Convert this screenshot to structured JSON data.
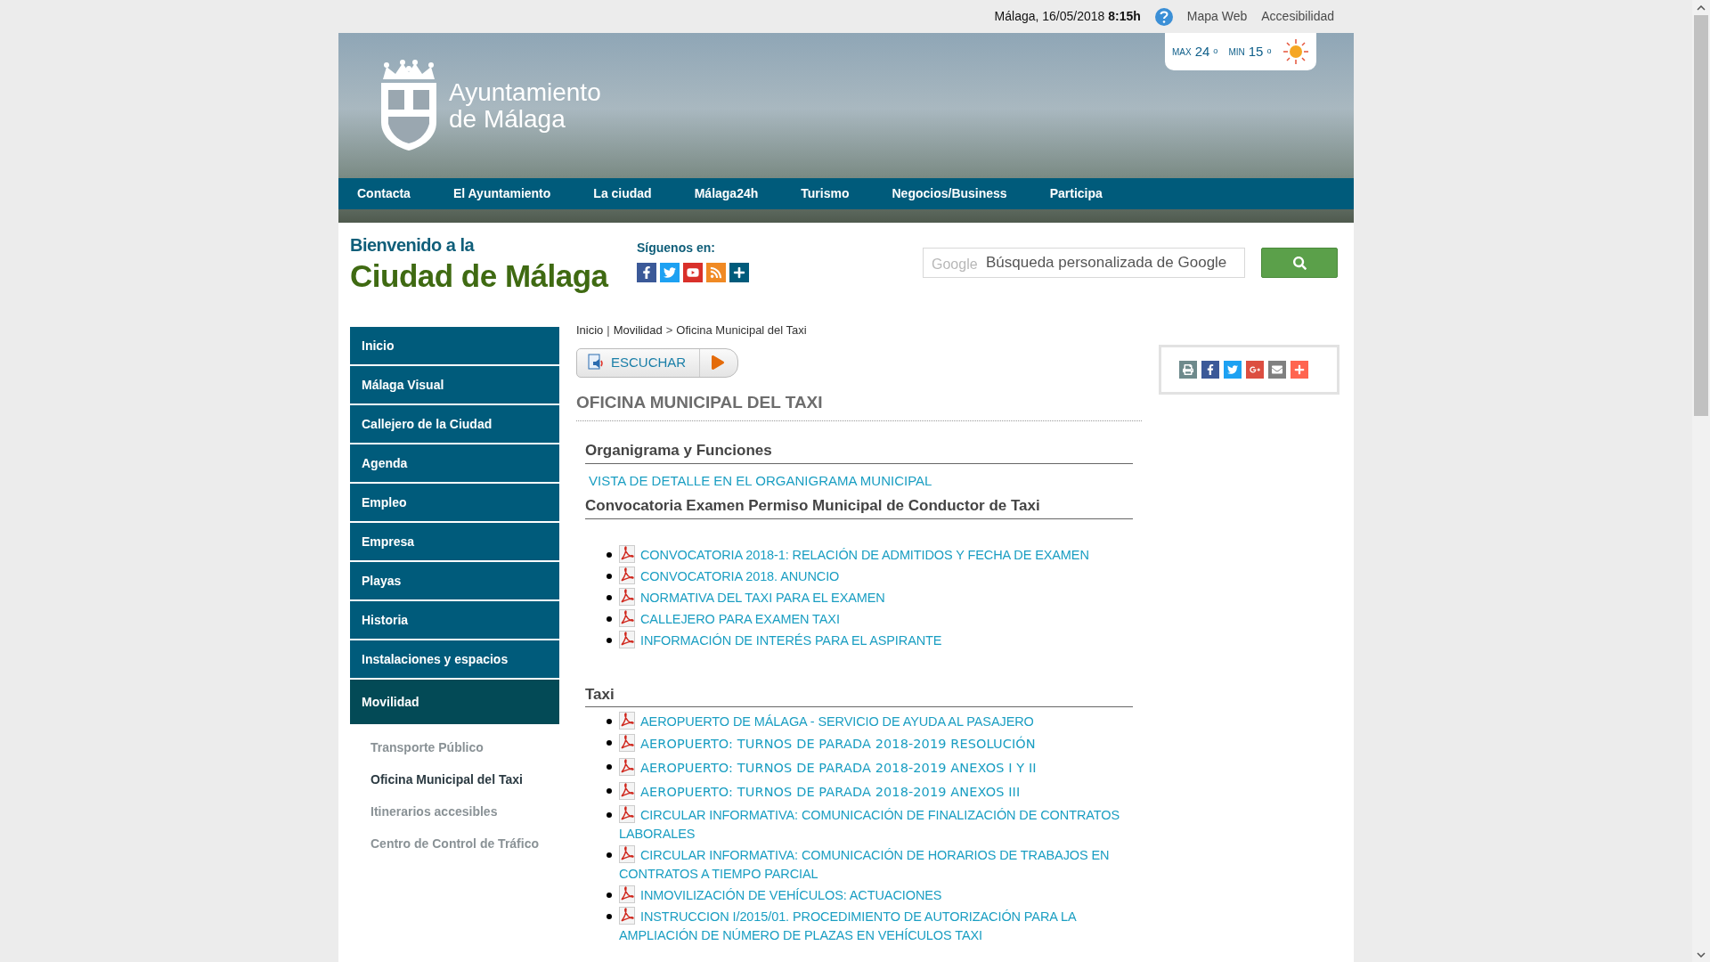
{
  "top_bar": {
    "place_date": "Málaga, 16/05/2018",
    "time": "8:15h",
    "links": [
      "Mapa Web",
      "Accesibilidad"
    ]
  },
  "banner": {
    "logo_lines": [
      "Ayuntamiento",
      "de Málaga"
    ],
    "weather": {
      "max_label": "MAX",
      "max": "24",
      "min_label": "MIN",
      "min": "15",
      "max_unit": "o",
      "min_unit": "o"
    }
  },
  "nav": [
    "Contacta",
    "El Ayuntamiento",
    "La ciudad",
    "Málaga24h",
    "Turismo",
    "Negocios/Business",
    "Participa"
  ],
  "welcome": {
    "line1": "Bienvenido a la",
    "line2": "Ciudad de Málaga"
  },
  "follow": {
    "label": "Síguenos en:",
    "networks": [
      {
        "kind": "facebook"
      },
      {
        "kind": "twitter"
      },
      {
        "kind": "youtube"
      },
      {
        "kind": "rss"
      },
      {
        "kind": "more"
      }
    ]
  },
  "search": {
    "brand": "Google",
    "placeholder": "Búsqueda personalizada de Google"
  },
  "sidebar": {
    "items": [
      {
        "label": "Inicio",
        "selected": false
      },
      {
        "label": "Málaga Visual",
        "selected": false
      },
      {
        "label": "Callejero de la Ciudad",
        "selected": false
      },
      {
        "label": "Agenda",
        "selected": false
      },
      {
        "label": "Empleo",
        "selected": false
      },
      {
        "label": "Empresa",
        "selected": false
      },
      {
        "label": "Playas",
        "selected": false
      },
      {
        "label": "Historia",
        "selected": false
      },
      {
        "label": "Instalaciones y espacios",
        "selected": false
      },
      {
        "label": "Movilidad",
        "selected": true
      }
    ],
    "subitems": [
      {
        "label": "Transporte Público",
        "selected": false
      },
      {
        "label": "Oficina Municipal del Taxi",
        "selected": true
      },
      {
        "label": "Itinerarios accesibles",
        "selected": false
      },
      {
        "label": "Centro de Control de Tráfico",
        "selected": false
      }
    ]
  },
  "breadcrumb": [
    {
      "kind": "link",
      "text": "Inicio"
    },
    {
      "kind": "sep",
      "text": "|"
    },
    {
      "kind": "link",
      "text": "Movilidad"
    },
    {
      "kind": "sep",
      "text": ">"
    },
    {
      "kind": "current",
      "text": "Oficina Municipal del Taxi"
    }
  ],
  "listen_button": "ESCUCHAR",
  "title": "OFICINA MUNICIPAL DEL TAXI",
  "sections": [
    {
      "heading": "Organigrama y Funciones",
      "link": "VISTA DE DETALLE EN EL ORGANIGRAMA MUNICIPAL"
    },
    {
      "heading": "Convocatoria Examen Permiso Municipal de Conductor de Taxi",
      "documents": [
        {
          "kind": "plain",
          "text": "CONVOCATORIA 2018-1: RELACIÓN DE ADMITIDOS Y FECHA DE EXAMEN"
        },
        {
          "kind": "plain",
          "text": "CONVOCATORIA 2018. ANUNCIO"
        },
        {
          "kind": "plain",
          "text": "NORMATIVA DEL TAXI PARA EL EXAMEN"
        },
        {
          "kind": "plain",
          "text": "CALLEJERO PARA EXAMEN TAXI"
        },
        {
          "kind": "plain",
          "text": "INFORMACIÓN DE INTERÉS PARA EL ASPIRANTE"
        }
      ]
    },
    {
      "heading": "Taxi",
      "documents": [
        {
          "kind": "plain",
          "text": "AEROPUERTO DE MÁLAGA - SERVICIO DE AYUDA AL PASAJERO"
        },
        {
          "kind": "alt",
          "text": "AEROPUERTO: TURNOS DE PARADA 2018-2019 RESOLUCIÓN"
        },
        {
          "kind": "alt",
          "text": "AEROPUERTO: TURNOS DE PARADA 2018-2019 ANEXOS I Y II"
        },
        {
          "kind": "alt",
          "text": "AEROPUERTO: TURNOS DE PARADA 2018-2019 ANEXOS III"
        },
        {
          "kind": "plain",
          "text": "CIRCULAR INFORMATIVA: COMUNICACIÓN DE FINALIZACIÓN DE CONTRATOS LABORALES"
        },
        {
          "kind": "plain",
          "text": "CIRCULAR INFORMATIVA: COMUNICACIÓN DE HORARIOS DE TRABAJOS EN CONTRATOS A TIEMPO PARCIAL"
        },
        {
          "kind": "plain",
          "text": "INMOVILIZACIÓN DE VEHÍCULOS:  ACTUACIONES"
        },
        {
          "kind": "plain",
          "text": "INSTRUCCION  I/2015/01. PROCEDIMIENTO DE AUTORIZACIÓN PARA LA AMPLIACIÓN DE NÚMERO DE PLAZAS EN VEHÍCULOS TAXI"
        }
      ]
    }
  ],
  "share": [
    {
      "kind": "print"
    },
    {
      "kind": "facebook"
    },
    {
      "kind": "twitter"
    },
    {
      "kind": "googleplus"
    },
    {
      "kind": "email"
    },
    {
      "kind": "more"
    }
  ]
}
